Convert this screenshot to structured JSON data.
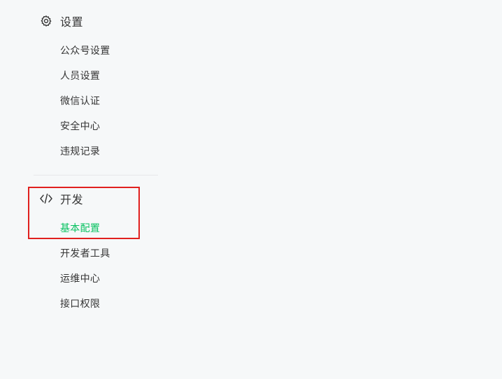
{
  "sidebar": {
    "settings": {
      "title": "设置",
      "icon": "gear-icon",
      "items": [
        {
          "label": "公众号设置"
        },
        {
          "label": "人员设置"
        },
        {
          "label": "微信认证"
        },
        {
          "label": "安全中心"
        },
        {
          "label": "违规记录"
        }
      ]
    },
    "develop": {
      "title": "开发",
      "icon": "code-icon",
      "items": [
        {
          "label": "基本配置",
          "active": true
        },
        {
          "label": "开发者工具"
        },
        {
          "label": "运维中心"
        },
        {
          "label": "接口权限"
        }
      ]
    }
  },
  "colors": {
    "active": "#07c160",
    "text": "#353535",
    "highlight_border": "#e0201e",
    "background": "#f6f8f9"
  }
}
